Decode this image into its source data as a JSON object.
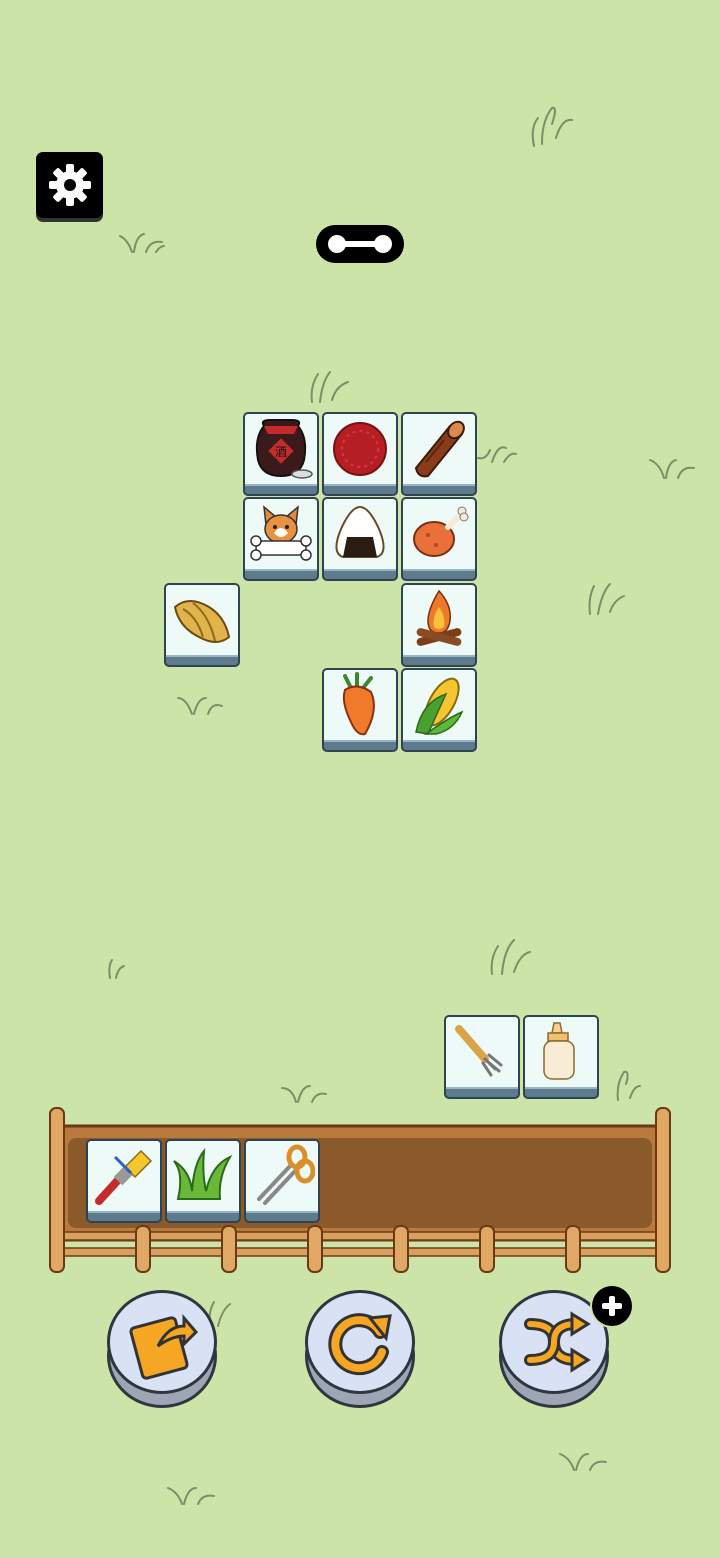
{
  "header": {
    "settings_icon": "gear-icon",
    "progress_icon": "progress-pill-icon"
  },
  "board": {
    "tiles": [
      {
        "item": "wine-jar"
      },
      {
        "item": "red-circle"
      },
      {
        "item": "log"
      },
      {
        "item": "corgi-with-bone"
      },
      {
        "item": "rice-ball"
      },
      {
        "item": "roast-chicken-leg"
      },
      {
        "item": "bamboo-shoot"
      },
      {
        "item": "campfire"
      },
      {
        "item": "carrot"
      },
      {
        "item": "corn"
      }
    ]
  },
  "side_stack": {
    "tiles": [
      {
        "item": "fork"
      },
      {
        "item": "baby-bottle"
      }
    ]
  },
  "tray": {
    "slots": 7,
    "tiles": [
      {
        "item": "paint-brush"
      },
      {
        "item": "grass-tuft"
      },
      {
        "item": "scissors"
      }
    ]
  },
  "powerups": [
    {
      "name": "move-out",
      "icon": "move-out-icon"
    },
    {
      "name": "undo",
      "icon": "undo-icon"
    },
    {
      "name": "shuffle",
      "icon": "shuffle-icon",
      "badge": "plus-icon"
    }
  ],
  "colors": {
    "background": "#cde4a8",
    "tile_face": "#eefaf8",
    "tile_side": "#5d7b8c",
    "tray_wood": "#8b5a2b",
    "accent_orange": "#f5a623"
  }
}
